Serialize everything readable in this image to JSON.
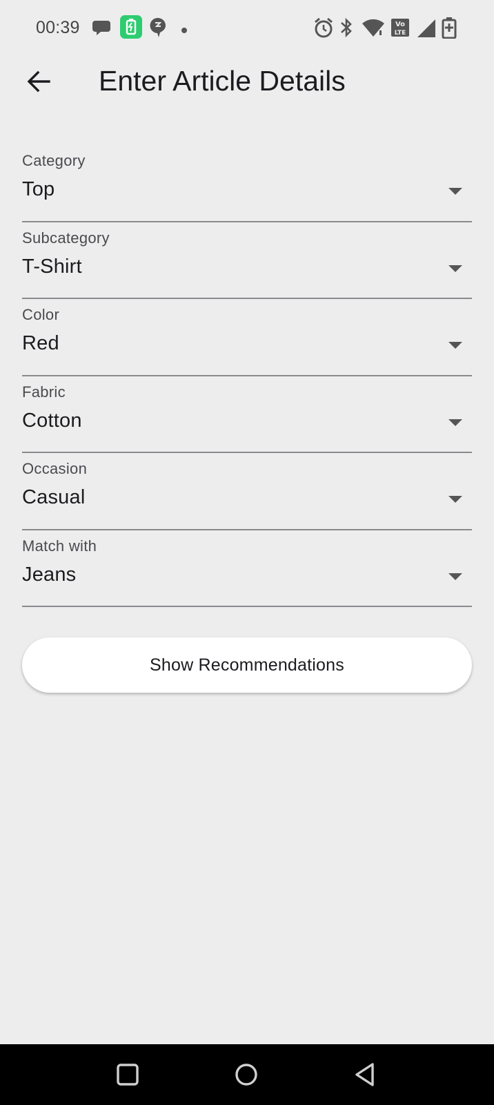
{
  "status_bar": {
    "time": "00:39",
    "left_icons": [
      "chat-bubbles-icon",
      "battery-saver-app-icon",
      "notification-app-icon",
      "more-dot-icon"
    ],
    "right_icons": [
      "alarm-icon",
      "bluetooth-icon",
      "wifi-icon",
      "volte-icon",
      "signal-icon",
      "battery-charging-icon"
    ],
    "app_badge_color": "#2ecc71"
  },
  "app_bar": {
    "back_icon": "arrow-back-icon",
    "title": "Enter Article Details"
  },
  "form": {
    "fields": [
      {
        "label": "Category",
        "value": "Top"
      },
      {
        "label": "Subcategory",
        "value": "T-Shirt"
      },
      {
        "label": "Color",
        "value": "Red"
      },
      {
        "label": "Fabric",
        "value": "Cotton"
      },
      {
        "label": "Occasion",
        "value": "Casual"
      },
      {
        "label": "Match with",
        "value": "Jeans"
      }
    ]
  },
  "actions": {
    "show_recommendations_label": "Show Recommendations"
  },
  "nav_bar": {
    "icons": [
      "recents-square-icon",
      "home-circle-icon",
      "back-triangle-icon"
    ]
  }
}
